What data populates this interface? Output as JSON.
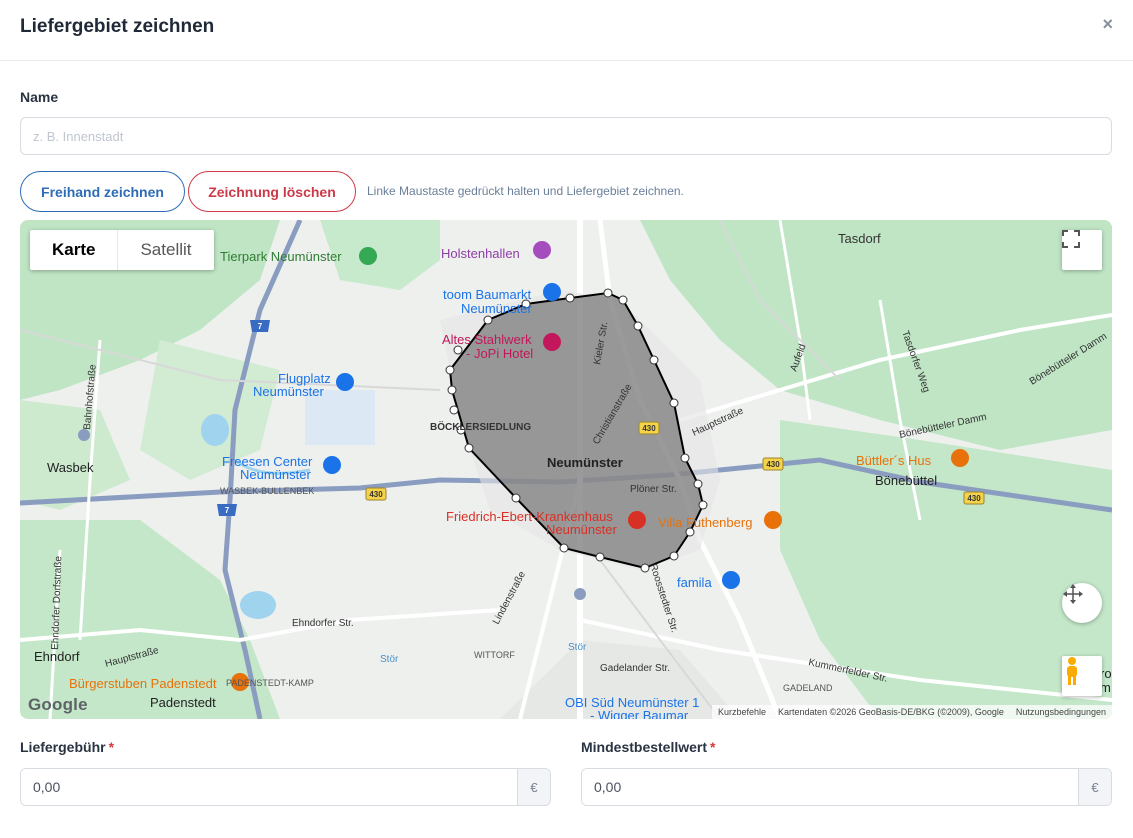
{
  "dialog": {
    "title": "Liefergebiet zeichnen",
    "close_symbol": "×"
  },
  "name_field": {
    "label": "Name",
    "placeholder": "z. B. Innenstadt",
    "value": ""
  },
  "toolbar": {
    "draw_label": "Freihand zeichnen",
    "clear_label": "Zeichnung löschen",
    "hint": "Linke Maustaste gedrückt halten und Liefergebiet zeichnen."
  },
  "map": {
    "type_control": {
      "map": "Karte",
      "satellite": "Satellit"
    },
    "labels": {
      "tasdorf": "Tasdorf",
      "tierpark": "Tierpark Neumünster",
      "holstenhallen": "Holstenhallen",
      "toom1": "toom Baumarkt",
      "toom2": "Neumünster",
      "stahl1": "Altes Stahlwerk",
      "stahl2": "- JoPi Hotel",
      "kieler": "Kieler Str.",
      "flug1": "Flugplatz",
      "flug2": "Neumünster",
      "boeckler": "BÖCKLERSIEDLUNG",
      "christian": "Christianstraße",
      "neumuenster": "Neumünster",
      "freesen1": "Freesen Center",
      "freesen2": "Neumünster",
      "wasbek": "Wasbek",
      "wasbek_bullenbek": "WASBEK-BULLENBEK",
      "hauptstr": "Hauptstraße",
      "aufeld": "Aufeld",
      "tasdorfer": "Tasdorfer Weg",
      "boenebuetteler_damm_1": "Bönebütteler Damm",
      "boenebuetteler_damm_2": "Bönebütteler Damm",
      "buettler": "Büttler´s Hus",
      "boenebuettel": "Bönebüttel",
      "ploener": "Plöner Str.",
      "fe1": "Friedrich-Ebert-Krankenhaus",
      "fe2": "Neumünster",
      "villa": "Villa Futhenberg",
      "famila": "famila",
      "lindenstr": "Lindenstraße",
      "roosstedter": "Roosstedter Str.",
      "bahnhofstr": "Bahnhofstraße",
      "ehndorfer_dorf": "Ehndorfer Dorfstraße",
      "ehndorfer_str": "Ehndorfer Str.",
      "ehndorf": "Ehndorf",
      "hauptstr2": "Hauptstraße",
      "wittorf": "WITTORF",
      "stoer1": "Stör",
      "stoer2": "Stör",
      "gadelander": "Gadelander Str.",
      "kummerfelder": "Kummerfelder Str.",
      "gadeland": "GADELAND",
      "buergerstuben": "Bürgerstuben Padenstedt",
      "padenstedt_kamp": "PADENSTEDT-KAMP",
      "padenstedt": "Padenstedt",
      "obi1": "OBI Süd Neumünster 1",
      "obi2": "- Wigger Baumar",
      "rd": "ro",
      "rd2": "m",
      "route430a": "430",
      "route430b": "430",
      "route430c": "430",
      "route430d": "430",
      "a7a": "7",
      "a7b": "7"
    },
    "google_logo": "Google",
    "attribution": {
      "shortcuts": "Kurzbefehle",
      "data": "Kartendaten ©2026 GeoBasis-DE/BKG (©2009), Google",
      "terms": "Nutzungsbedingungen"
    }
  },
  "fees": {
    "delivery_label": "Liefergebühr",
    "delivery_value": "0,00",
    "delivery_unit": "€",
    "min_order_label": "Mindestbestellwert",
    "min_order_value": "0,00",
    "min_order_unit": "€",
    "required_mark": "*"
  },
  "colors": {
    "primary": "#2e6db5",
    "danger": "#cc3a4a",
    "polygon_fill": "#6b6b6b",
    "map_green": "#bfe5c5"
  }
}
